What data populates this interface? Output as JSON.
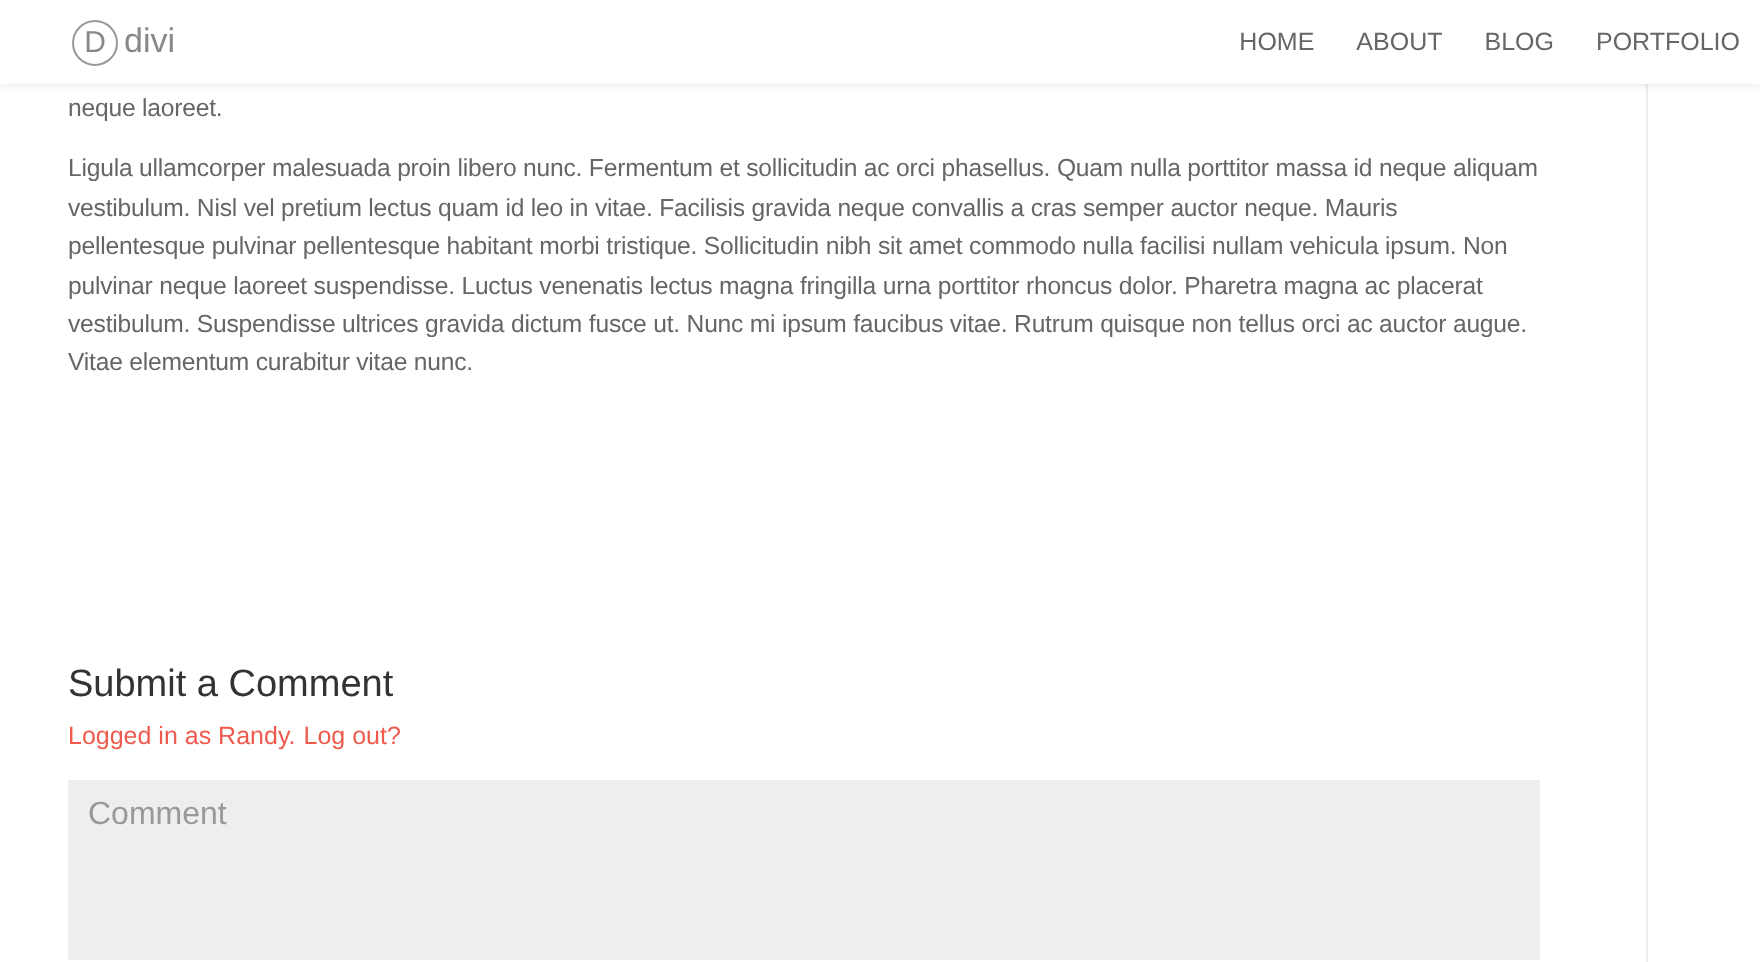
{
  "header": {
    "logo": {
      "mark": "D",
      "name": "divi"
    },
    "nav": [
      {
        "label": "HOME"
      },
      {
        "label": "ABOUT"
      },
      {
        "label": "BLOG"
      },
      {
        "label": "PORTFOLIO"
      }
    ]
  },
  "article": {
    "paragraphs": [
      "neque laoreet.",
      "Ligula ullamcorper malesuada proin libero nunc. Fermentum et sollicitudin ac orci phasellus. Quam nulla porttitor massa id neque aliquam vestibulum. Nisl vel pretium lectus quam id leo in vitae. Facilisis gravida neque convallis a cras semper auctor neque. Mauris pellentesque pulvinar pellentesque habitant morbi tristique. Sollicitudin nibh sit amet commodo nulla facilisi nullam vehicula ipsum. Non pulvinar neque laoreet suspendisse. Luctus venenatis lectus magna fringilla urna porttitor rhoncus dolor. Pharetra magna ac placerat vestibulum. Suspendisse ultrices gravida dictum fusce ut. Nunc mi ipsum faucibus vitae. Rutrum quisque non tellus orci ac auctor augue. Vitae elementum curabitur vitae nunc."
    ]
  },
  "comments": {
    "title": "Submit a Comment",
    "logged_in": "Logged in as Randy.",
    "logout": "Log out?",
    "field": {
      "placeholder": "Comment"
    }
  }
}
